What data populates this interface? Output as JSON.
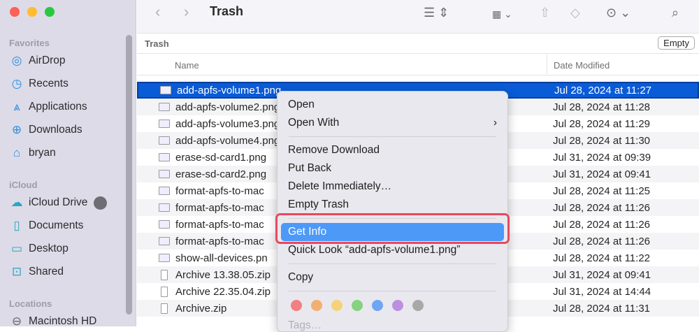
{
  "window": {
    "title": "Trash"
  },
  "toolbar": {
    "icons": [
      "back-icon",
      "forward-icon",
      "list-view-icon",
      "group-icon",
      "share-icon",
      "tag-icon",
      "more-icon",
      "search-icon"
    ]
  },
  "sidebar": {
    "sections": [
      "Favorites",
      "iCloud",
      "Locations"
    ],
    "favorites": [
      {
        "label": "AirDrop",
        "icon": "airdrop-icon"
      },
      {
        "label": "Recents",
        "icon": "clock-icon"
      },
      {
        "label": "Applications",
        "icon": "applications-icon"
      },
      {
        "label": "Downloads",
        "icon": "download-icon"
      },
      {
        "label": "bryan",
        "icon": "home-icon"
      }
    ],
    "icloud": [
      {
        "label": "iCloud Drive",
        "icon": "cloud-icon"
      },
      {
        "label": "Documents",
        "icon": "document-icon"
      },
      {
        "label": "Desktop",
        "icon": "desktop-icon"
      },
      {
        "label": "Shared",
        "icon": "shared-folder-icon"
      }
    ],
    "locations": [
      {
        "label": "Macintosh HD",
        "icon": "disk-icon"
      }
    ]
  },
  "pathbar": {
    "title": "Trash",
    "empty_label": "Empty"
  },
  "columns": {
    "name": "Name",
    "date": "Date Modified"
  },
  "files": [
    {
      "name": "add-apfs-volume1.png",
      "date": "Jul 28, 2024 at 11:27",
      "selected": true
    },
    {
      "name": "add-apfs-volume2.png",
      "date": "Jul 28, 2024 at 11:28"
    },
    {
      "name": "add-apfs-volume3.png",
      "date": "Jul 28, 2024 at 11:29"
    },
    {
      "name": "add-apfs-volume4.png",
      "date": "Jul 28, 2024 at 11:30"
    },
    {
      "name": "erase-sd-card1.png",
      "date": "Jul 31, 2024 at 09:39"
    },
    {
      "name": "erase-sd-card2.png",
      "date": "Jul 31, 2024 at 09:41"
    },
    {
      "name": "format-apfs-to-mac",
      "date": "Jul 28, 2024 at 11:25"
    },
    {
      "name": "format-apfs-to-mac",
      "date": "Jul 28, 2024 at 11:26"
    },
    {
      "name": "format-apfs-to-mac",
      "date": "Jul 28, 2024 at 11:26"
    },
    {
      "name": "format-apfs-to-mac",
      "date": "Jul 28, 2024 at 11:26"
    },
    {
      "name": "show-all-devices.pn",
      "date": "Jul 28, 2024 at 11:22"
    },
    {
      "name": "Archive 13.38.05.zip",
      "date": "Jul 31, 2024 at 09:41"
    },
    {
      "name": "Archive 22.35.04.zip",
      "date": "Jul 31, 2024 at 14:44"
    },
    {
      "name": "Archive.zip",
      "date": "Jul 28, 2024 at 11:31"
    }
  ],
  "context_menu": {
    "items": [
      "Open",
      "Open With",
      "Remove Download",
      "Put Back",
      "Delete Immediately…",
      "Empty Trash",
      "Get Info",
      "Quick Look “add-apfs-volume1.png”",
      "Copy",
      "Tags…"
    ],
    "highlighted": "Get Info",
    "tag_colors": [
      "#f27f82",
      "#f3ae73",
      "#f5d27a",
      "#86d27f",
      "#6fa6f3",
      "#be8ee0",
      "#a8a8a8"
    ],
    "highlight_color": "#4d99f7",
    "annotation_color": "#e9485f"
  }
}
